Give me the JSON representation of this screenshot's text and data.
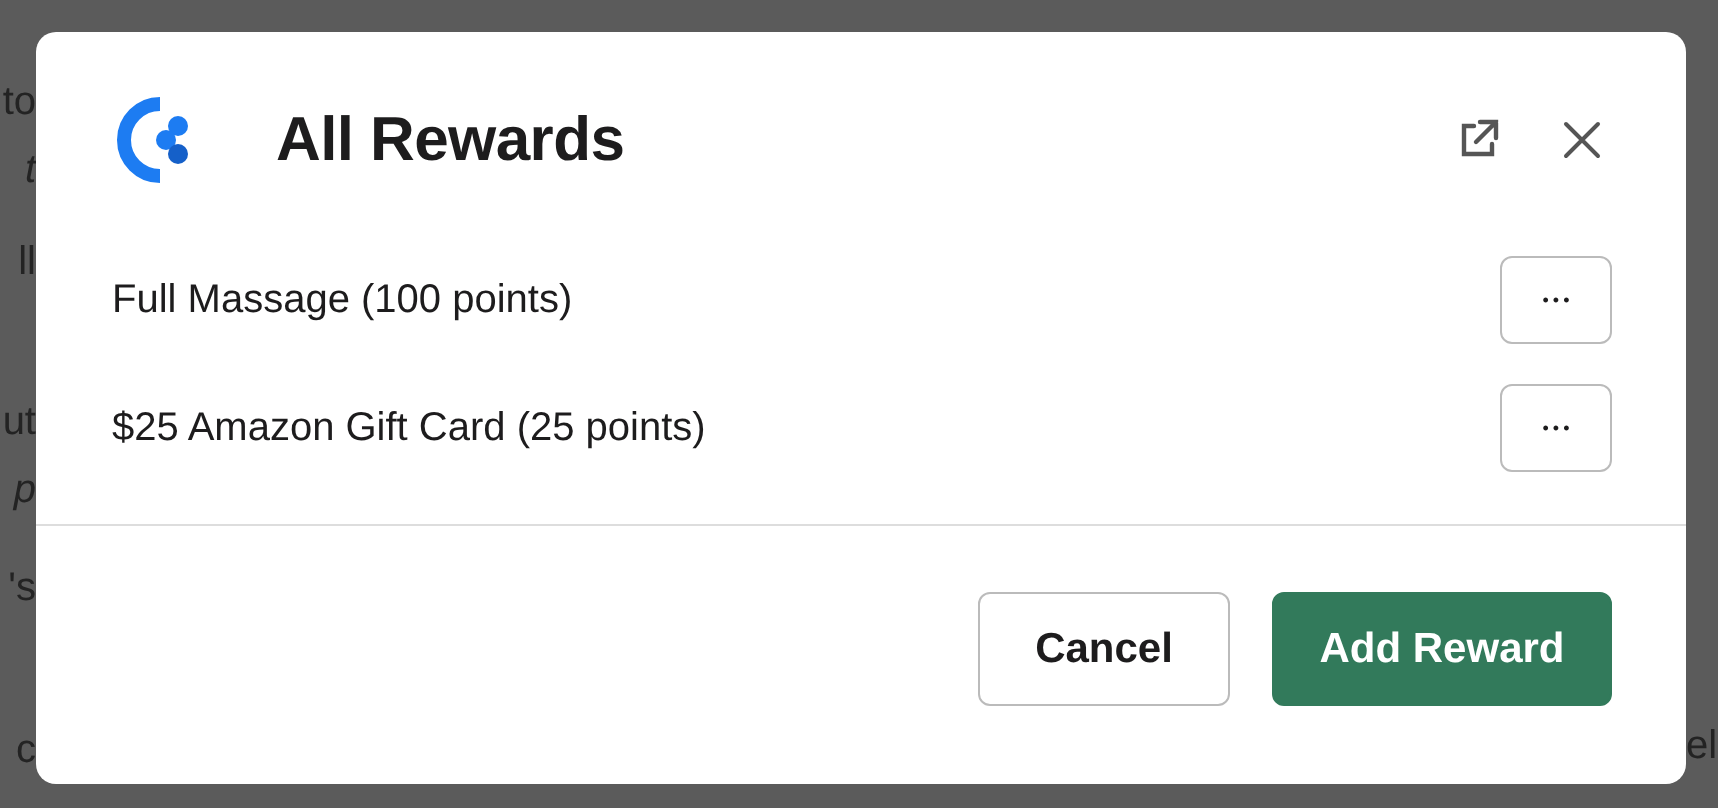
{
  "background_text": {
    "left": [
      {
        "text": "to",
        "italic": false
      },
      {
        "text": "t",
        "italic": true
      },
      {
        "text": "ll",
        "italic": false
      },
      {
        "text": "ut",
        "italic": false
      },
      {
        "text": "p",
        "italic": true
      },
      {
        "text": "'s",
        "italic": false
      },
      {
        "text": "c",
        "italic": false
      }
    ],
    "right": [
      {
        "text": "el",
        "italic": false
      }
    ]
  },
  "dialog": {
    "title": "All Rewards",
    "rewards": [
      {
        "label": "Full Massage (100 points)",
        "menu": "•••"
      },
      {
        "label": "$25 Amazon Gift Card (25 points)",
        "menu": "•••"
      }
    ],
    "buttons": [
      {
        "label": "Cancel",
        "kind": "secondary"
      },
      {
        "label": "Add Reward",
        "kind": "primary"
      }
    ]
  }
}
